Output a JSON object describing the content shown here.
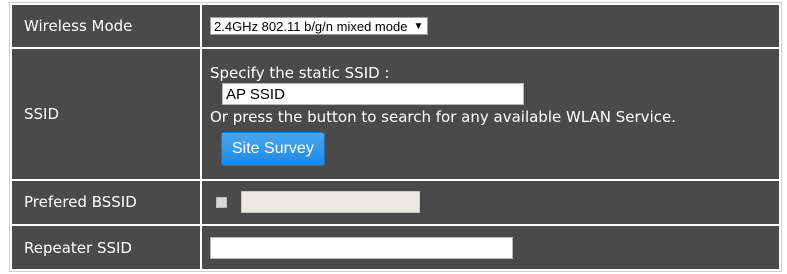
{
  "wireless_mode": {
    "label": "Wireless Mode",
    "selected": "2.4GHz 802.11 b/g/n mixed mode"
  },
  "ssid": {
    "label": "SSID",
    "instruction": "Specify the static SSID :",
    "value": "AP SSID",
    "search_hint": "Or press the button to search for any available WLAN Service.",
    "survey_button": "Site Survey"
  },
  "preferred_bssid": {
    "label": "Prefered BSSID",
    "checked": false,
    "value": ""
  },
  "repeater_ssid": {
    "label": "Repeater SSID",
    "value": ""
  },
  "icons": {
    "dropdown_arrow": "▼"
  },
  "colors": {
    "cell_background": "#4a4a4a",
    "button_blue": "#1e88e5"
  }
}
